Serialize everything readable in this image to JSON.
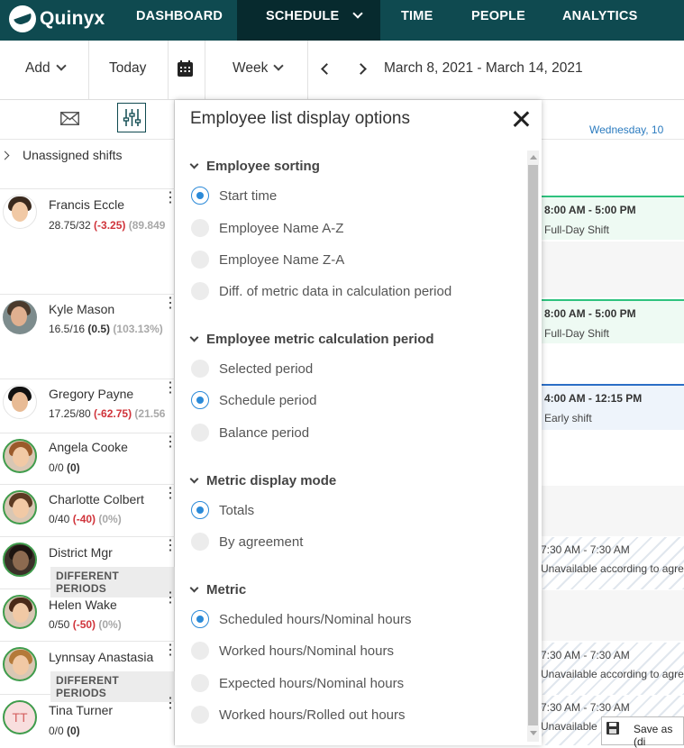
{
  "app": {
    "logo_text": "Quinyx"
  },
  "nav": {
    "dashboard": "DASHBOARD",
    "schedule": "SCHEDULE",
    "time": "TIME",
    "people": "PEOPLE",
    "analytics": "ANALYTICS"
  },
  "toolbar": {
    "add": "Add",
    "today": "Today",
    "view": "Week",
    "date_range": "March 8, 2021 - March 14, 2021"
  },
  "left": {
    "unassigned": "Unassigned shifts",
    "employees": [
      {
        "name": "Francis Eccle",
        "hours": "28.75/32 ",
        "diff": "(-3.25)",
        "pct": " (89.849"
      },
      {
        "name": "Kyle Mason",
        "hours": "16.5/16 ",
        "diff": "(0.5)",
        "pct": " (103.13%)"
      },
      {
        "name": "Gregory Payne",
        "hours": "17.25/80 ",
        "diff": "(-62.75)",
        "pct": " (21.56"
      },
      {
        "name": "Angela Cooke",
        "hours": "0/0 ",
        "diff": "(0)",
        "pct": ""
      },
      {
        "name": "Charlotte Colbert",
        "hours": "0/40 ",
        "diff": "(-40)",
        "pct": " (0%)"
      },
      {
        "name": "District Mgr",
        "badge": "DIFFERENT PERIODS"
      },
      {
        "name": "Helen Wake",
        "hours": "0/50 ",
        "diff": "(-50)",
        "pct": " (0%)"
      },
      {
        "name": "Lynnsay Anastasia",
        "badge": "DIFFERENT PERIODS"
      },
      {
        "name": "Tina Turner",
        "hours": "0/0 ",
        "diff": "(0)",
        "pct": "",
        "initials": "TT"
      }
    ]
  },
  "grid": {
    "day_header": "Wednesday, 10",
    "shifts": [
      {
        "time": "8:00 AM - 5:00 PM",
        "type": "Full-Day Shift"
      },
      {
        "time": "8:00 AM - 5:00 PM",
        "type": "Full-Day Shift"
      },
      {
        "time": "4:00 AM - 12:15 PM",
        "type": "Early shift"
      }
    ],
    "unavailable": [
      {
        "time": "7:30 AM - 7:30 AM",
        "text": "Unavailable according to agre"
      },
      {
        "time": "7:30 AM - 7:30 AM",
        "text": "Unavailable according to agre"
      },
      {
        "time": "7:30 AM - 7:30 AM",
        "text": "Unavailable"
      }
    ],
    "context_menu": {
      "save_as": "Save as (di"
    }
  },
  "panel": {
    "title": "Employee list display options",
    "sections": [
      {
        "title": "Employee sorting",
        "options": [
          "Start time",
          "Employee Name A-Z",
          "Employee Name Z-A",
          "Diff. of metric data in calculation period"
        ],
        "selected": 0
      },
      {
        "title": "Employee metric calculation period",
        "options": [
          "Selected period",
          "Schedule period",
          "Balance period"
        ],
        "selected": 1
      },
      {
        "title": "Metric display mode",
        "options": [
          "Totals",
          "By agreement"
        ],
        "selected": 0
      },
      {
        "title": "Metric",
        "options": [
          "Scheduled hours/Nominal hours",
          "Worked hours/Nominal hours",
          "Expected hours/Nominal hours",
          "Worked hours/Rolled out hours"
        ],
        "selected": 0
      }
    ]
  },
  "colors": {
    "nav_bg": "#0f4a50",
    "nav_active": "#072a2e",
    "accent_blue": "#2b8ad8",
    "shift_green": "#2ec27e",
    "negative": "#d0343b"
  }
}
